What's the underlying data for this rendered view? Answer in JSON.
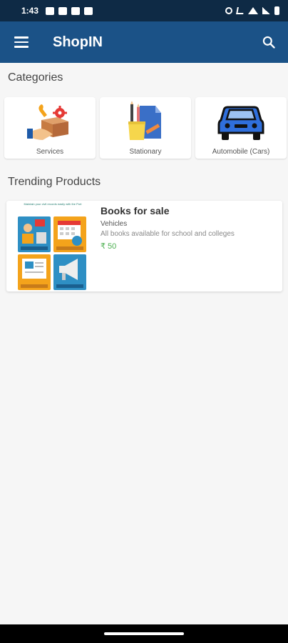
{
  "status_bar": {
    "time": "1:43"
  },
  "app_bar": {
    "title": "ShopIN"
  },
  "sections": {
    "categories": "Categories",
    "trending": "Trending Products"
  },
  "categories": [
    {
      "label": "Services",
      "icon": "services-icon"
    },
    {
      "label": "Stationary",
      "icon": "stationary-icon"
    },
    {
      "label": "Automobile (Cars)",
      "icon": "car-icon"
    }
  ],
  "trending": [
    {
      "name": "Books for sale",
      "category": "Vehicles",
      "description": "All books available for school and colleges",
      "price": "₹ 50",
      "thumbnail_caption": "Maintain your civil records easily with the Port"
    }
  ],
  "colors": {
    "app_bar": "#1b5287",
    "status_bar": "#0e2a45",
    "price": "#4caf50",
    "background": "#f6f6f6"
  }
}
